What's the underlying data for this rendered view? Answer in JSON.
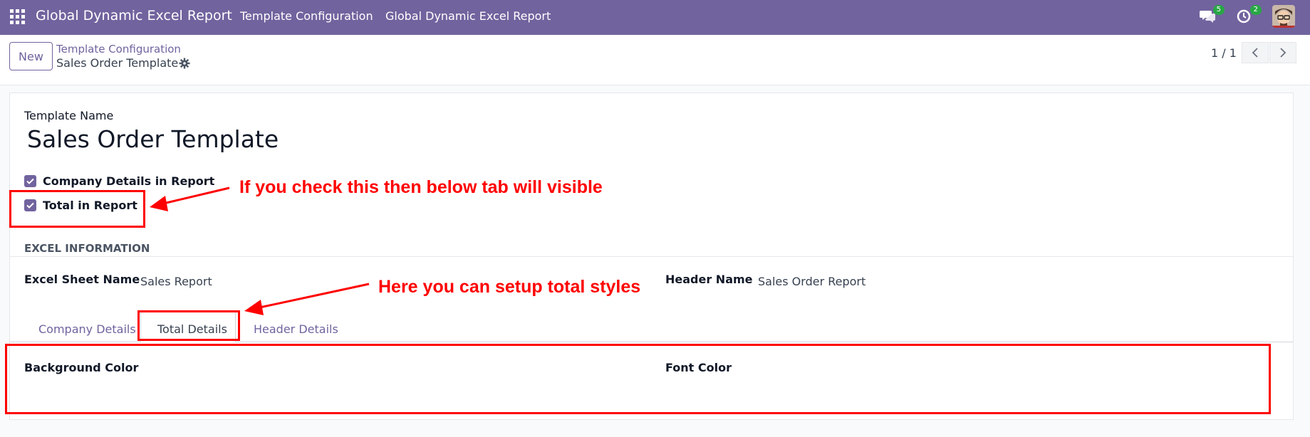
{
  "navbar": {
    "app_title": "Global Dynamic Excel Report",
    "menu": [
      {
        "label": "Template Configuration"
      },
      {
        "label": "Global Dynamic Excel Report"
      }
    ],
    "messages_badge": "5",
    "activities_badge": "2",
    "color": "#71639e"
  },
  "control_panel": {
    "new_label": "New",
    "breadcrumb_parent": "Template Configuration",
    "breadcrumb_current": "Sales Order Template",
    "pager": "1 / 1"
  },
  "form": {
    "template_name_label": "Template Name",
    "template_name_value": "Sales Order Template",
    "checkboxes": [
      {
        "label": "Company Details in Report",
        "checked": true
      },
      {
        "label": "Total in Report",
        "checked": true
      }
    ],
    "section_title": "EXCEL INFORMATION",
    "excel_sheet_name_label": "Excel Sheet Name",
    "excel_sheet_name_value": "Sales Report",
    "header_name_label": "Header Name",
    "header_name_value": "Sales Order Report",
    "tabs": [
      {
        "label": "Company Details",
        "active": false
      },
      {
        "label": "Total Details",
        "active": true
      },
      {
        "label": "Header Details",
        "active": false
      }
    ],
    "background_color_label": "Background Color",
    "font_color_label": "Font Color"
  },
  "annotations": {
    "note1": "If you check this then below tab will visible",
    "note2": "Here you can setup total styles",
    "color": "#ff0000"
  }
}
